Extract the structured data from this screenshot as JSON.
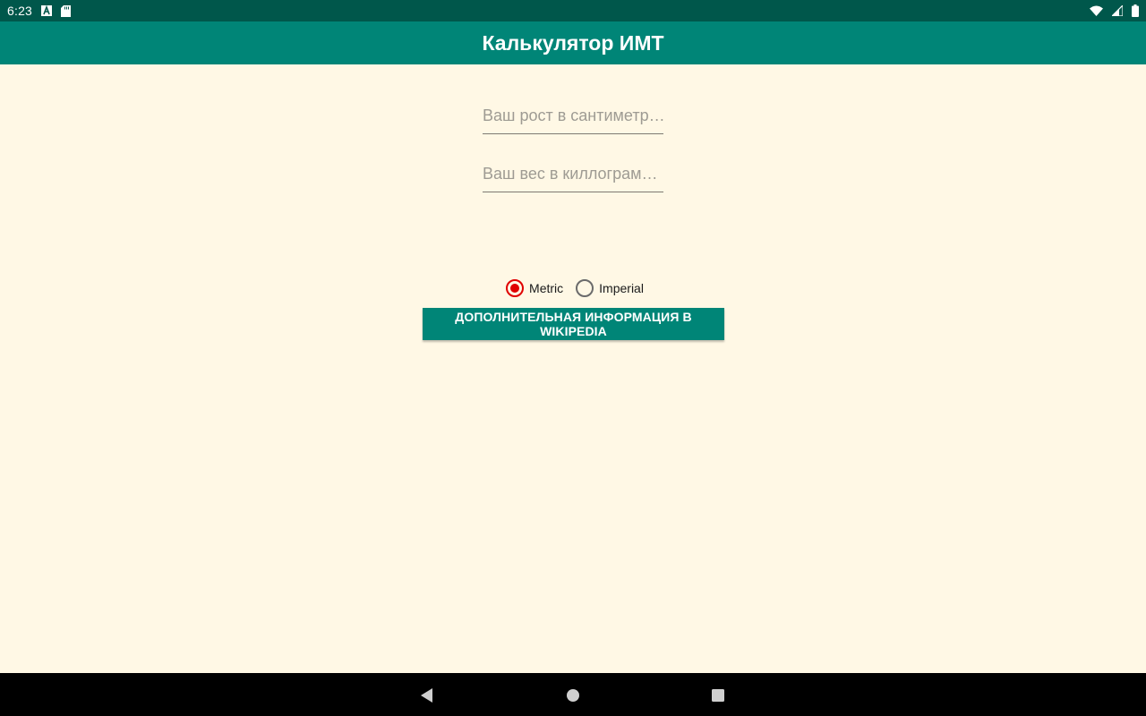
{
  "status_bar": {
    "time": "6:23",
    "left_icons": [
      "font-a-icon",
      "sd-card-icon"
    ],
    "right_icons": [
      "wifi-icon",
      "signal-icon",
      "battery-icon"
    ]
  },
  "app_bar": {
    "title": "Калькулятор ИМТ"
  },
  "form": {
    "height_placeholder": "Ваш рост в сантиметр…",
    "height_value": "",
    "weight_placeholder": "Ваш вес в киллограм…",
    "weight_value": ""
  },
  "units": {
    "options": [
      "Metric",
      "Imperial"
    ],
    "selected": "Metric"
  },
  "wiki_button_label": "ДОПОЛНИТЕЛЬНАЯ ИНФОРМАЦИЯ В WIKIPEDIA",
  "nav_bar": {
    "icons": [
      "back-icon",
      "home-icon",
      "recents-icon"
    ]
  },
  "colors": {
    "status_bar": "#00574b",
    "app_bar": "#008577",
    "background": "#fff8e5",
    "radio_accent": "#e00000",
    "nav_bar": "#000000"
  }
}
